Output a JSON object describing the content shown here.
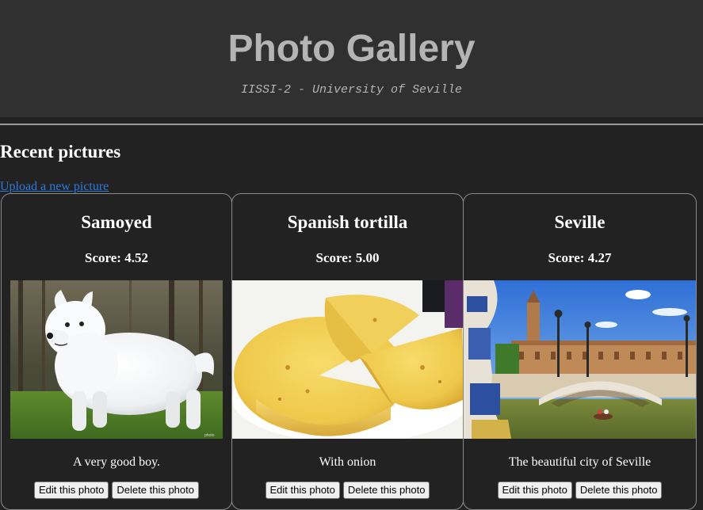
{
  "header": {
    "title": "Photo Gallery",
    "subtitle": "IISSI-2 - University of Seville"
  },
  "section": {
    "title": "Recent pictures",
    "upload_link": "Upload a new picture"
  },
  "colors": {
    "background": "#222222",
    "header_background": "#303030",
    "header_text": "#b4b4b4",
    "link": "#2f7ad8",
    "card_border": "#8a8a8a"
  },
  "photos": [
    {
      "title": "Samoyed",
      "score_text": "Score: 4.52",
      "description": "A very good boy.",
      "edit_label": "Edit this photo",
      "delete_label": "Delete this photo",
      "image": "samoyed-dog-photo"
    },
    {
      "title": "Spanish tortilla",
      "score_text": "Score: 5.00",
      "description": "With onion",
      "edit_label": "Edit this photo",
      "delete_label": "Delete this photo",
      "image": "spanish-tortilla-photo"
    },
    {
      "title": "Seville",
      "score_text": "Score: 4.27",
      "description": "The beautiful city of Seville",
      "edit_label": "Edit this photo",
      "delete_label": "Delete this photo",
      "image": "seville-plaza-photo"
    }
  ]
}
